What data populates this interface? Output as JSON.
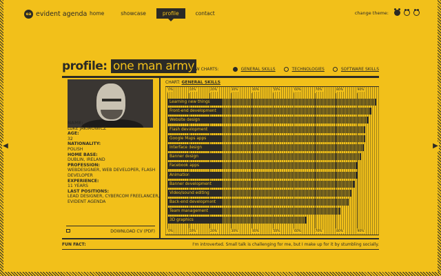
{
  "header": {
    "logo_mark": "ea",
    "logo_text": "evident agenda",
    "nav": [
      {
        "label": "home"
      },
      {
        "label": "showcase"
      },
      {
        "label": "profile"
      },
      {
        "label": "contact"
      }
    ],
    "theme_label": "change theme:"
  },
  "title": {
    "key": "profile:",
    "value": "one man army"
  },
  "view_charts": {
    "label": "VIEW CHARTS:",
    "items": [
      {
        "label": "GENERAL SKILLS"
      },
      {
        "label": "TECHNOLOGIES"
      },
      {
        "label": "SOFTWARE SKILLS"
      }
    ]
  },
  "profile": {
    "name_label": "NAME:",
    "name": "LUKE JAKIMOWICZ",
    "age_label": "AGE:",
    "age": "32",
    "nationality_label": "NATIONALITY:",
    "nationality": "POLISH",
    "home_label": "HOME BASE:",
    "home": "DUBLIN, IRELAND",
    "profession_label": "PROFESSION:",
    "profession": "WEBDESIGNER, WEB DEVELOPER, FLASH DEVELOPER",
    "experience_label": "EXPERIENCE:",
    "experience": "11 YEARS",
    "positions_label": "LAST POSITIONS:",
    "positions": "LEAD DESIGNER, CYBERCOM FREELANCER, EVIDENT AGENDA",
    "download": "DOWNLOAD CV (PDF)"
  },
  "chart_data": {
    "type": "bar",
    "title": "GENERAL SKILLS",
    "title_prefix": "CHART:",
    "ticks": [
      "0%",
      "10%",
      "20%",
      "30%",
      "40%",
      "50%",
      "60%",
      "70%",
      "80%",
      "90%"
    ],
    "categories": [
      "Learning new things",
      "Front-end development",
      "Website design",
      "Flash development",
      "Google Maps apps",
      "Interface design",
      "Banner design",
      "Facebook apps",
      "Animation",
      "Banner development",
      "Video/sound editing",
      "Back-end development",
      "Team management",
      "3D graphics"
    ],
    "values": [
      100,
      97,
      95,
      93,
      93,
      92,
      90,
      88,
      88,
      86,
      84,
      82,
      77,
      55
    ],
    "ylim": [
      0,
      100
    ]
  },
  "fun_fact": {
    "label": "FUN FACT:",
    "text": "I'm introverted. Small talk is challenging for me, but I make up for it by stumbling socially."
  },
  "colors": {
    "background": "#f2c01a",
    "ink": "#2b2a26"
  }
}
